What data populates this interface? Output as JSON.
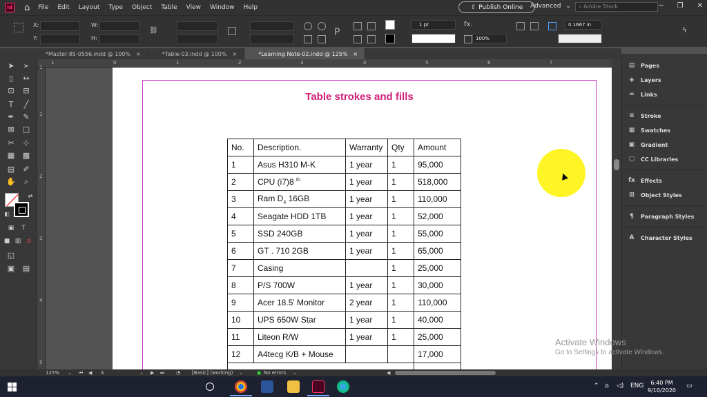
{
  "app": {
    "icon_label": "Id",
    "menus": [
      "File",
      "Edit",
      "Layout",
      "Type",
      "Object",
      "Table",
      "View",
      "Window",
      "Help"
    ],
    "publish_label": "Publish Online",
    "workspace": "Advanced",
    "stock_placeholder": "Adobe Stock"
  },
  "control": {
    "x_label": "X:",
    "y_label": "Y:",
    "w_label": "W:",
    "h_label": "H:",
    "stroke_weight": "1 pt",
    "zoom_pct": "100%",
    "inset": "0.1667 in"
  },
  "tabs": [
    {
      "label": "*Master-85-0556.indd @ 100%"
    },
    {
      "label": "*Table-03.indd @ 100%"
    },
    {
      "label": "*Learning Note-02.indd @ 125%"
    }
  ],
  "ruler": {
    "h": [
      "1",
      "0",
      "1",
      "2",
      "3",
      "4",
      "5",
      "6",
      "7"
    ],
    "v": [
      "1",
      "1",
      "2",
      "3",
      "4",
      "5"
    ]
  },
  "document": {
    "title": "Table strokes and fills",
    "headers": [
      "No.",
      "Description.",
      "Warranty",
      "Qty",
      "Amount"
    ],
    "rows": [
      {
        "no": "1",
        "desc": "Asus H310 M-K",
        "warranty": "1 year",
        "qty": "1",
        "amount": "95,000"
      },
      {
        "no": "2",
        "desc": "CPU (i7)8",
        "desc_sup": "th",
        "warranty": "1 year",
        "qty": "1",
        "amount": "518,000"
      },
      {
        "no": "3",
        "desc": "Ram D",
        "desc_sub": "4",
        "desc_tail": " 16GB",
        "warranty": "1 year",
        "qty": "1",
        "amount": "110,000"
      },
      {
        "no": "4",
        "desc": "Seagate HDD 1TB",
        "warranty": "1 year",
        "qty": "1",
        "amount": "52,000"
      },
      {
        "no": "5",
        "desc": "SSD 240GB",
        "warranty": "1 year",
        "qty": "1",
        "amount": "55,000"
      },
      {
        "no": "6",
        "desc": "GT . 710 2GB",
        "warranty": "1 year",
        "qty": "1",
        "amount": "65,000"
      },
      {
        "no": "7",
        "desc": "Casing",
        "warranty": "",
        "qty": "1",
        "amount": "25,000"
      },
      {
        "no": "8",
        "desc": "P/S 700W",
        "warranty": "1 year",
        "qty": "1",
        "amount": "30,000"
      },
      {
        "no": "9",
        "desc": "Acer 18.5' Monitor",
        "warranty": "2 year",
        "qty": "1",
        "amount": "110,000"
      },
      {
        "no": "10",
        "desc": "UPS 650W Star",
        "warranty": "1 year",
        "qty": "1",
        "amount": "40,000"
      },
      {
        "no": "11",
        "desc": "Liteon R/W",
        "warranty": "1 year",
        "qty": "1",
        "amount": "25,000"
      },
      {
        "no": "12",
        "desc": "A4tecg K/B + Mouse",
        "warranty": "",
        "qty": "",
        "amount": "17,000"
      }
    ]
  },
  "panels": [
    {
      "label": "Pages",
      "icon": "pages-icon",
      "glyph": "▤"
    },
    {
      "label": "Layers",
      "icon": "layers-icon",
      "glyph": "◈"
    },
    {
      "label": "Links",
      "icon": "links-icon",
      "glyph": "∞"
    },
    {
      "label": "Stroke",
      "icon": "stroke-icon",
      "glyph": "≡"
    },
    {
      "label": "Swatches",
      "icon": "swatches-icon",
      "glyph": "▦"
    },
    {
      "label": "Gradient",
      "icon": "gradient-icon",
      "glyph": "▣"
    },
    {
      "label": "CC Libraries",
      "icon": "cc-libraries-icon",
      "glyph": "▢"
    },
    {
      "label": "Effects",
      "icon": "effects-icon",
      "glyph": "fx"
    },
    {
      "label": "Object Styles",
      "icon": "object-styles-icon",
      "glyph": "⊞"
    },
    {
      "label": "Paragraph Styles",
      "icon": "paragraph-styles-icon",
      "glyph": "¶"
    },
    {
      "label": "Character Styles",
      "icon": "character-styles-icon",
      "glyph": "A"
    }
  ],
  "watermark": {
    "line1": "Activate Windows",
    "line2": "Go to Settings to activate Windows."
  },
  "status": {
    "zoom": "125%",
    "page": "4",
    "style": "[Basic] (working)",
    "errors": "No errors"
  },
  "taskbar": {
    "lang": "ENG",
    "time": "6:40 PM",
    "date": "9/10/2020"
  }
}
